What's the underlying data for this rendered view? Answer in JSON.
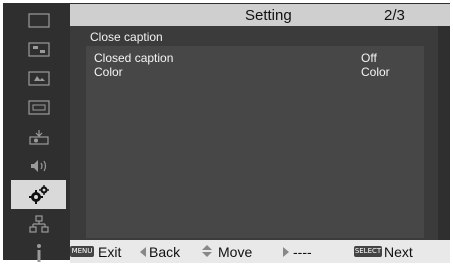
{
  "header": {
    "title": "Setting",
    "page": "2/3"
  },
  "section": {
    "title": "Close caption"
  },
  "rows": [
    {
      "label": "Closed caption",
      "value": "Off"
    },
    {
      "label": "Color",
      "value": "Color"
    }
  ],
  "sidebar": {
    "items": [
      {
        "icon": "display-icon"
      },
      {
        "icon": "image-adjust-icon"
      },
      {
        "icon": "screen-icon"
      },
      {
        "icon": "input-icon"
      },
      {
        "icon": "projector-setup-icon"
      },
      {
        "icon": "sound-icon"
      },
      {
        "icon": "setting-gears-icon",
        "active": true
      },
      {
        "icon": "network-icon"
      },
      {
        "icon": "info-icon"
      }
    ]
  },
  "footer": {
    "menu_icon": "MENU",
    "exit_label": "Exit",
    "back_label": "Back",
    "move_label": "Move",
    "next_dash_label": "----",
    "select_icon": "SELECT",
    "next_label": "Next"
  }
}
